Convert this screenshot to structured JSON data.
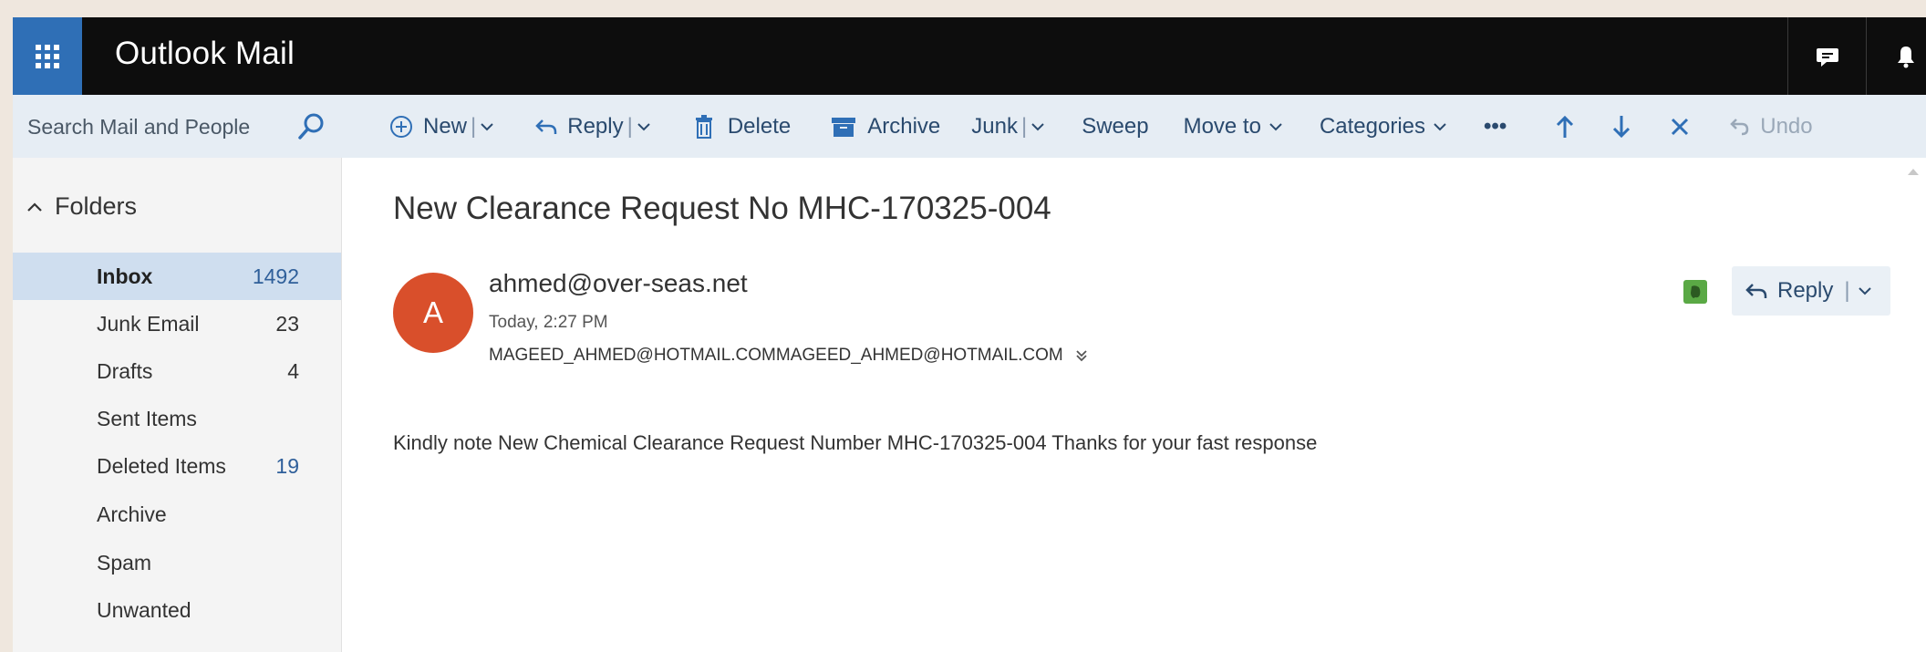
{
  "app": {
    "title": "Outlook Mail"
  },
  "topbar": {
    "icons": [
      "waffle-icon",
      "chat-icon",
      "bell-icon"
    ]
  },
  "search": {
    "placeholder": "Search Mail and People"
  },
  "toolbar": {
    "new_label": "New",
    "reply_label": "Reply",
    "delete_label": "Delete",
    "archive_label": "Archive",
    "junk_label": "Junk",
    "sweep_label": "Sweep",
    "moveto_label": "Move to",
    "categories_label": "Categories",
    "more_label": "•••",
    "undo_label": "Undo"
  },
  "sidebar": {
    "folders_heading": "Folders",
    "items": [
      {
        "label": "Inbox",
        "count": "1492"
      },
      {
        "label": "Junk Email",
        "count": "23"
      },
      {
        "label": "Drafts",
        "count": "4"
      },
      {
        "label": "Sent Items",
        "count": ""
      },
      {
        "label": "Deleted Items",
        "count": "19"
      },
      {
        "label": "Archive",
        "count": ""
      },
      {
        "label": "Spam",
        "count": ""
      },
      {
        "label": "Unwanted",
        "count": ""
      }
    ]
  },
  "message": {
    "subject": "New Clearance Request No MHC-170325-004",
    "avatar_letter": "A",
    "sender": "ahmed@over-seas.net",
    "date": "Today, 2:27 PM",
    "recipients": "MAGEED_AHMED@HOTMAIL.COMMAGEED_AHMED@HOTMAIL.COM",
    "body": "Kindly note New Chemical Clearance Request Number MHC-170325-004 Thanks for your fast response",
    "reply_label": "Reply"
  },
  "colors": {
    "brand_blue": "#2f6fb6",
    "topbar": "#0d0d0d",
    "avatar": "#d94f2b",
    "selected_folder": "#cfdeef",
    "evernote_green": "#5aa945"
  }
}
